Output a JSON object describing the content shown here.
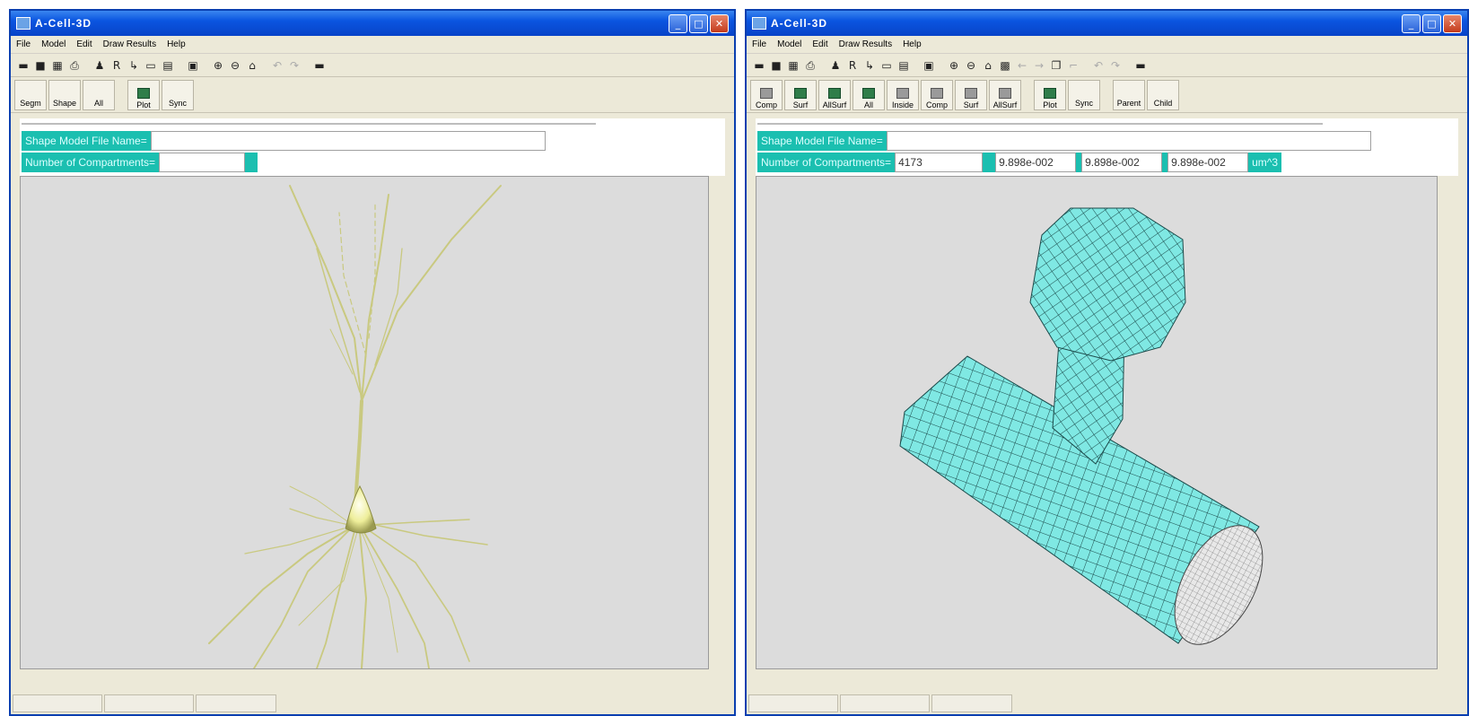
{
  "windows": [
    {
      "title": "A-Cell-3D",
      "title_buttons": [
        "min",
        "max",
        "close"
      ],
      "menu": [
        "File",
        "Model",
        "Edit",
        "Draw Results",
        "Help"
      ],
      "toolbar_icons": [
        "open-folder-icon",
        "save-icon",
        "model-icon",
        "print-icon",
        "person-icon",
        "r-icon",
        "arrow-icon",
        "rect-icon",
        "grid-icon",
        "cube-icon",
        "zoom-in-icon",
        "zoom-out-icon",
        "home-icon",
        "undo-icon",
        "redo-icon",
        "more-icon"
      ],
      "buttons": [
        "Segm",
        "Shape",
        "All",
        "Plot",
        "Sync"
      ],
      "labels": {
        "shape_model_file": "Shape Model File Name=",
        "num_compartments": "Number of Compartments="
      },
      "values": {
        "shape_model_file": "",
        "num_compartments": ""
      },
      "scene": "neuron",
      "colors": {
        "label_bg": "#1bbfb0",
        "neuron": "#e6e69a"
      }
    },
    {
      "title": "A-Cell-3D",
      "title_buttons": [
        "min",
        "max",
        "close"
      ],
      "menu": [
        "File",
        "Model",
        "Edit",
        "Draw Results",
        "Help"
      ],
      "toolbar_icons": [
        "open-folder-icon",
        "save-icon",
        "model-icon",
        "print-icon",
        "person-icon",
        "r-icon",
        "arrow-icon",
        "rect-icon",
        "grid-icon",
        "cube-icon",
        "zoom-in-icon",
        "zoom-out-icon",
        "select-icon",
        "move-icon",
        "left-arrow-icon",
        "right-arrow-icon",
        "copy-icon",
        "paste-icon",
        "undo-icon",
        "redo-icon",
        "more-icon"
      ],
      "buttons": [
        "Comp",
        "Surf",
        "AllSurf",
        "All",
        "Inside",
        "Comp",
        "Surf",
        "AllSurf",
        "Plot",
        "Sync",
        "Parent",
        "Child"
      ],
      "labels": {
        "shape_model_file": "Shape Model File Name=",
        "num_compartments": "Number of Compartments="
      },
      "values": {
        "shape_model_file": "",
        "num_compartments": "4173",
        "dim1": "9.898e-002",
        "dim2": "9.898e-002",
        "dim3": "9.898e-002",
        "unit": "um^3"
      },
      "scene": "spine-mesh",
      "colors": {
        "label_bg": "#1bbfb0",
        "mesh": "#7fe8e3"
      }
    }
  ]
}
